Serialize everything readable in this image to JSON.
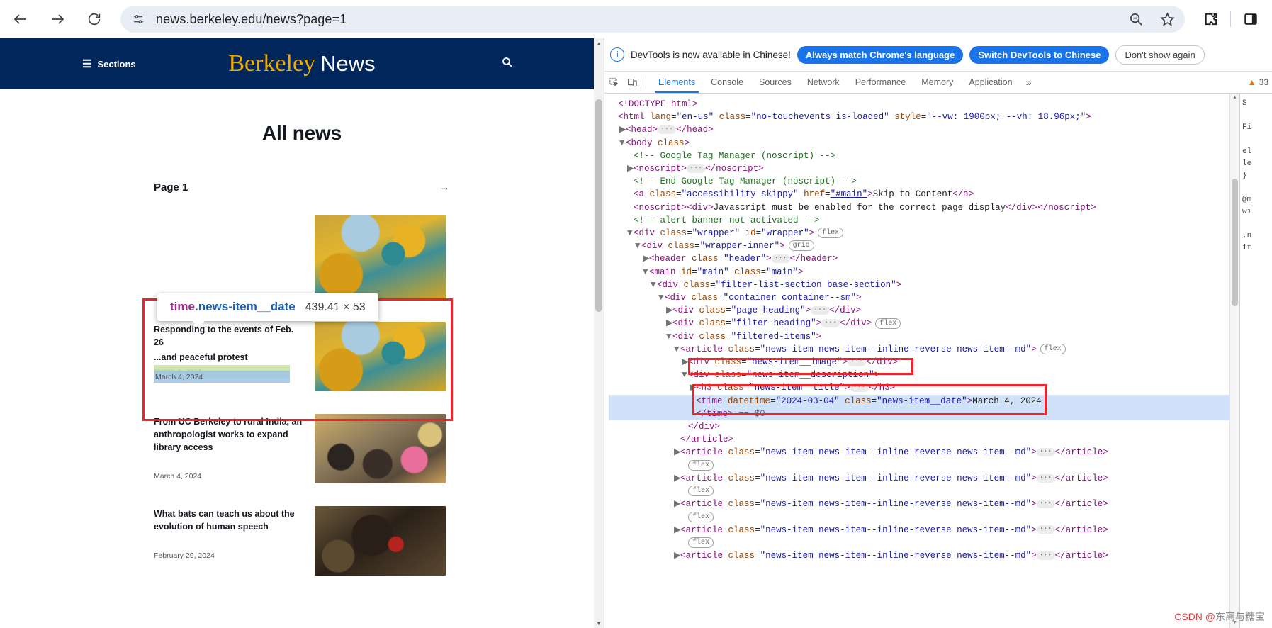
{
  "browser": {
    "back_icon": "arrow-left-icon",
    "forward_icon": "arrow-right-icon",
    "reload_icon": "reload-icon",
    "site_info_icon": "tune-icon",
    "url": "news.berkeley.edu/news?page=1",
    "zoom_out_icon": "zoom-out-icon",
    "bookmark_icon": "star-icon",
    "extensions_icon": "puzzle-icon",
    "side_panel_icon": "side-panel-icon"
  },
  "site": {
    "sections_label": "Sections",
    "brand_first": "Berkeley",
    "brand_second": "News",
    "search_icon": "search-icon",
    "page_title": "All news",
    "filter_heading": "Page 1",
    "next_arrow": "→",
    "ghost_title": "...and peaceful protest",
    "items": [
      {
        "title": "Responding to the events of Feb. 26",
        "date": "March 4, 2024",
        "photo": "campanile-autumn"
      },
      {
        "title": "From UC Berkeley to rural India, an anthropologist works to expand library access",
        "date": "March 4, 2024",
        "photo": "india-library"
      },
      {
        "title": "What bats can teach us about the evolution of human speech",
        "date": "February 29, 2024",
        "photo": "bat-fruit"
      }
    ],
    "highlighted_date": "March 4, 2024"
  },
  "inspector": {
    "tooltip_tag": "time",
    "tooltip_class": ".news-item__date",
    "tooltip_dimensions": "439.41 × 53"
  },
  "devtools": {
    "banner": {
      "info_icon": "info-icon",
      "message": "DevTools is now available in Chinese!",
      "primary_btn": "Always match Chrome's language",
      "secondary_btn": "Switch DevTools to Chinese",
      "dismiss_btn": "Don't show again"
    },
    "inspect_icon": "inspect-element-icon",
    "device_icon": "device-toolbar-icon",
    "tabs": [
      {
        "label": "Elements",
        "active": true
      },
      {
        "label": "Console",
        "active": false
      },
      {
        "label": "Sources",
        "active": false
      },
      {
        "label": "Network",
        "active": false
      },
      {
        "label": "Performance",
        "active": false
      },
      {
        "label": "Memory",
        "active": false
      },
      {
        "label": "Application",
        "active": false
      }
    ],
    "more_tabs": "»",
    "warning_icon": "warning-triangle-icon",
    "warning_count": "33",
    "styles_pane_text": "S\n\nFi\n\nel\nle\n}\n\n@m\nwi\n\n.n\nit",
    "dom_lines": [
      {
        "indent": 0,
        "tri": "",
        "html": "<span class=\"punct\">&lt;!DOCTYPE html&gt;</span>"
      },
      {
        "indent": 0,
        "tri": "",
        "html": "<span class=\"punct\">&lt;</span><span class=\"tag-name\">html</span> <span class=\"attr-name\">lang</span>=<span class=\"attr-val\">\"en-us\"</span> <span class=\"attr-name\">class</span>=<span class=\"attr-val\">\"no-touchevents is-loaded\"</span> <span class=\"attr-name\">style</span>=<span class=\"attr-val\">\"--vw: 1900px; --vh: 18.96px;\"</span><span class=\"punct\">&gt;</span>"
      },
      {
        "indent": 1,
        "tri": "▶",
        "html": "<span class=\"punct\">&lt;</span><span class=\"tag-name\">head</span><span class=\"punct\">&gt;</span><span class=\"ellip\">···</span><span class=\"punct\">&lt;/</span><span class=\"tag-name\">head</span><span class=\"punct\">&gt;</span>"
      },
      {
        "indent": 1,
        "tri": "▼",
        "html": "<span class=\"punct\">&lt;</span><span class=\"tag-name\">body</span> <span class=\"attr-name\">class</span><span class=\"punct\">&gt;</span>"
      },
      {
        "indent": 2,
        "tri": "",
        "html": "<span class=\"comment\">&lt;!-- Google Tag Manager (noscript) --&gt;</span>"
      },
      {
        "indent": 2,
        "tri": "▶",
        "html": "<span class=\"punct\">&lt;</span><span class=\"tag-name\">noscript</span><span class=\"punct\">&gt;</span><span class=\"ellip\">···</span><span class=\"punct\">&lt;/</span><span class=\"tag-name\">noscript</span><span class=\"punct\">&gt;</span>"
      },
      {
        "indent": 2,
        "tri": "",
        "html": "<span class=\"comment\">&lt;!-- End Google Tag Manager (noscript) --&gt;</span>"
      },
      {
        "indent": 2,
        "tri": "",
        "html": "<span class=\"punct\">&lt;</span><span class=\"tag-name\">a</span> <span class=\"attr-name\">class</span>=<span class=\"attr-val\">\"accessibility skippy\"</span> <span class=\"attr-name\">href</span>=<span class=\"attr-val\" style=\"text-decoration:underline\">\"#main\"</span><span class=\"punct\">&gt;</span><span class=\"txt\">Skip to Content</span><span class=\"punct\">&lt;/</span><span class=\"tag-name\">a</span><span class=\"punct\">&gt;</span>"
      },
      {
        "indent": 2,
        "tri": "",
        "html": "<span class=\"punct\">&lt;</span><span class=\"tag-name\">noscript</span><span class=\"punct\">&gt;&lt;</span><span class=\"tag-name\">div</span><span class=\"punct\">&gt;</span><span class=\"txt\">Javascript must be enabled for the correct page display</span><span class=\"punct\">&lt;/</span><span class=\"tag-name\">div</span><span class=\"punct\">&gt;&lt;/</span><span class=\"tag-name\">noscript</span><span class=\"punct\">&gt;</span>"
      },
      {
        "indent": 2,
        "tri": "",
        "html": "<span class=\"comment\">&lt;!-- alert banner not activated --&gt;</span>"
      },
      {
        "indent": 2,
        "tri": "▼",
        "html": "<span class=\"punct\">&lt;</span><span class=\"tag-name\">div</span> <span class=\"attr-name\">class</span>=<span class=\"attr-val\">\"wrapper\"</span> <span class=\"attr-name\">id</span>=<span class=\"attr-val\">\"wrapper\"</span><span class=\"punct\">&gt;</span><span class=\"badge\">flex</span>"
      },
      {
        "indent": 3,
        "tri": "▼",
        "html": "<span class=\"punct\">&lt;</span><span class=\"tag-name\">div</span> <span class=\"attr-name\">class</span>=<span class=\"attr-val\">\"wrapper-inner\"</span><span class=\"punct\">&gt;</span><span class=\"badge\">grid</span>"
      },
      {
        "indent": 4,
        "tri": "▶",
        "html": "<span class=\"punct\">&lt;</span><span class=\"tag-name\">header</span> <span class=\"attr-name\">class</span>=<span class=\"attr-val\">\"header\"</span><span class=\"punct\">&gt;</span><span class=\"ellip\">···</span><span class=\"punct\">&lt;/</span><span class=\"tag-name\">header</span><span class=\"punct\">&gt;</span>"
      },
      {
        "indent": 4,
        "tri": "▼",
        "html": "<span class=\"punct\">&lt;</span><span class=\"tag-name\">main</span> <span class=\"attr-name\">id</span>=<span class=\"attr-val\">\"main\"</span> <span class=\"attr-name\">class</span>=<span class=\"attr-val\">\"main\"</span><span class=\"punct\">&gt;</span>"
      },
      {
        "indent": 5,
        "tri": "▼",
        "html": "<span class=\"punct\">&lt;</span><span class=\"tag-name\">div</span> <span class=\"attr-name\">class</span>=<span class=\"attr-val\">\"filter-list-section base-section\"</span><span class=\"punct\">&gt;</span>"
      },
      {
        "indent": 6,
        "tri": "▼",
        "html": "<span class=\"punct\">&lt;</span><span class=\"tag-name\">div</span> <span class=\"attr-name\">class</span>=<span class=\"attr-val\">\"container container--sm\"</span><span class=\"punct\">&gt;</span>"
      },
      {
        "indent": 7,
        "tri": "▶",
        "html": "<span class=\"punct\">&lt;</span><span class=\"tag-name\">div</span> <span class=\"attr-name\">class</span>=<span class=\"attr-val\">\"page-heading\"</span><span class=\"punct\">&gt;</span><span class=\"ellip\">···</span><span class=\"punct\">&lt;/</span><span class=\"tag-name\">div</span><span class=\"punct\">&gt;</span>"
      },
      {
        "indent": 7,
        "tri": "▶",
        "html": "<span class=\"punct\">&lt;</span><span class=\"tag-name\">div</span> <span class=\"attr-name\">class</span>=<span class=\"attr-val\">\"filter-heading\"</span><span class=\"punct\">&gt;</span><span class=\"ellip\">···</span><span class=\"punct\">&lt;/</span><span class=\"tag-name\">div</span><span class=\"punct\">&gt;</span><span class=\"badge\">flex</span>"
      },
      {
        "indent": 7,
        "tri": "▼",
        "html": "<span class=\"punct\">&lt;</span><span class=\"tag-name\">div</span> <span class=\"attr-name\">class</span>=<span class=\"attr-val\">\"filtered-items\"</span><span class=\"punct\">&gt;</span>"
      },
      {
        "indent": 8,
        "tri": "▼",
        "html": "<span class=\"punct\">&lt;</span><span class=\"tag-name\">article</span> <span class=\"attr-name\">class</span>=<span class=\"attr-val\">\"news-item news-item--inline-reverse news-item--md\"</span><span class=\"punct\">&gt;</span><span class=\"badge\">flex</span>"
      },
      {
        "indent": 9,
        "tri": "▶",
        "html": "<span class=\"punct\">&lt;</span><span class=\"tag-name\">div</span> <span class=\"attr-name\">class</span>=<span class=\"attr-val\">\"news-item__image\"</span><span class=\"punct\">&gt;</span><span class=\"ellip\">···</span><span class=\"punct\">&lt;/</span><span class=\"tag-name\">div</span><span class=\"punct\">&gt;</span>"
      },
      {
        "indent": 9,
        "tri": "▼",
        "html": "<span class=\"punct\">&lt;</span><span class=\"tag-name\">div</span> <span class=\"attr-name\">class</span>=<span class=\"attr-val\">\"news-item__description\"</span><span class=\"punct\">&gt;</span>"
      },
      {
        "indent": 10,
        "tri": "▶",
        "html": "<span class=\"punct\">&lt;</span><span class=\"tag-name\">h3</span> <span class=\"attr-name\">class</span>=<span class=\"attr-val\">\"news-item__title\"</span><span class=\"punct\">&gt;</span><span class=\"ellip\">···</span><span class=\"punct\">&lt;/</span><span class=\"tag-name\">h3</span><span class=\"punct\">&gt;</span>"
      },
      {
        "indent": 10,
        "tri": "",
        "sel": true,
        "html": "<span class=\"punct\">&lt;</span><span class=\"tag-name\">time</span> <span class=\"attr-name\">datetime</span>=<span class=\"attr-val\">\"2024-03-04\"</span> <span class=\"attr-name\">class</span>=<span class=\"attr-val\">\"news-item__date\"</span><span class=\"punct\">&gt;</span><span class=\"txt\">March 4, 2024</span>"
      },
      {
        "indent": 10,
        "tri": "",
        "sel": true,
        "html": "<span class=\"punct\">&lt;/</span><span class=\"tag-name\">time</span><span class=\"punct\">&gt;</span> <span class=\"dollar\">== $0</span>"
      },
      {
        "indent": 9,
        "tri": "",
        "html": "<span class=\"punct\">&lt;/</span><span class=\"tag-name\">div</span><span class=\"punct\">&gt;</span>"
      },
      {
        "indent": 8,
        "tri": "",
        "html": "<span class=\"punct\">&lt;/</span><span class=\"tag-name\">article</span><span class=\"punct\">&gt;</span>"
      },
      {
        "indent": 8,
        "tri": "▶",
        "html": "<span class=\"punct\">&lt;</span><span class=\"tag-name\">article</span> <span class=\"attr-name\">class</span>=<span class=\"attr-val\">\"news-item news-item--inline-reverse news-item--md\"</span><span class=\"punct\">&gt;</span><span class=\"ellip\">···</span><span class=\"punct\">&lt;/</span><span class=\"tag-name\">article</span><span class=\"punct\">&gt;</span>"
      },
      {
        "indent": 9,
        "tri": "",
        "html": "<span class=\"badge\" style=\"margin-left:0\">flex</span>"
      },
      {
        "indent": 8,
        "tri": "▶",
        "html": "<span class=\"punct\">&lt;</span><span class=\"tag-name\">article</span> <span class=\"attr-name\">class</span>=<span class=\"attr-val\">\"news-item news-item--inline-reverse news-item--md\"</span><span class=\"punct\">&gt;</span><span class=\"ellip\">···</span><span class=\"punct\">&lt;/</span><span class=\"tag-name\">article</span><span class=\"punct\">&gt;</span>"
      },
      {
        "indent": 9,
        "tri": "",
        "html": "<span class=\"badge\" style=\"margin-left:0\">flex</span>"
      },
      {
        "indent": 8,
        "tri": "▶",
        "html": "<span class=\"punct\">&lt;</span><span class=\"tag-name\">article</span> <span class=\"attr-name\">class</span>=<span class=\"attr-val\">\"news-item news-item--inline-reverse news-item--md\"</span><span class=\"punct\">&gt;</span><span class=\"ellip\">···</span><span class=\"punct\">&lt;/</span><span class=\"tag-name\">article</span><span class=\"punct\">&gt;</span>"
      },
      {
        "indent": 9,
        "tri": "",
        "html": "<span class=\"badge\" style=\"margin-left:0\">flex</span>"
      },
      {
        "indent": 8,
        "tri": "▶",
        "html": "<span class=\"punct\">&lt;</span><span class=\"tag-name\">article</span> <span class=\"attr-name\">class</span>=<span class=\"attr-val\">\"news-item news-item--inline-reverse news-item--md\"</span><span class=\"punct\">&gt;</span><span class=\"ellip\">···</span><span class=\"punct\">&lt;/</span><span class=\"tag-name\">article</span><span class=\"punct\">&gt;</span>"
      },
      {
        "indent": 9,
        "tri": "",
        "html": "<span class=\"badge\" style=\"margin-left:0\">flex</span>"
      },
      {
        "indent": 8,
        "tri": "▶",
        "html": "<span class=\"punct\">&lt;</span><span class=\"tag-name\">article</span> <span class=\"attr-name\">class</span>=<span class=\"attr-val\">\"news-item news-item--inline-reverse news-item--md\"</span><span class=\"punct\">&gt;</span><span class=\"ellip\">···</span><span class=\"punct\">&lt;/</span><span class=\"tag-name\">article</span><span class=\"punct\">&gt;</span>"
      }
    ]
  },
  "watermark": {
    "prefix": "CSDN @",
    "name": "东离与糖宝"
  }
}
